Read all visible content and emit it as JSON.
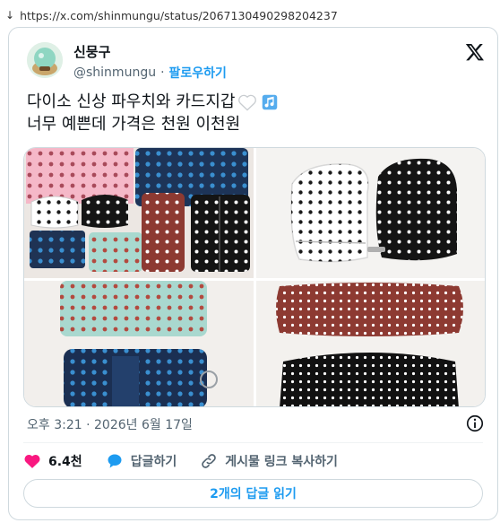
{
  "browser": {
    "url": "https://x.com/shinmungu/status/2067130490298204237"
  },
  "author": {
    "name": "신뭉구",
    "handle": "@shinmungu",
    "separator": "·",
    "follow_label": "팔로우하기"
  },
  "tweet": {
    "line1": "다이소 신상 파우치와 카드지갑",
    "line2": "너무 예쁜데 가격은 천원 이천원",
    "emoji": [
      "white-heart-icon",
      "music-notes-icon"
    ]
  },
  "media": {
    "images": [
      "pouches-collection-photo",
      "dotted-coin-purses-photo",
      "mint-card-wallet-photo",
      "brown-black-pouches-photo"
    ]
  },
  "meta": {
    "timestamp": "오후 3:21 · 2026년 6월 17일"
  },
  "actions": {
    "like_count": "6.4천",
    "reply_label": "답글하기",
    "copy_link_label": "게시물 링크 복사하기"
  },
  "replies": {
    "read_label": "2개의 답글 읽기"
  },
  "colors": {
    "accent": "#1d9bf0",
    "like": "#f91880",
    "text": "#0f1419",
    "muted": "#536471",
    "border": "#cfd9de"
  }
}
